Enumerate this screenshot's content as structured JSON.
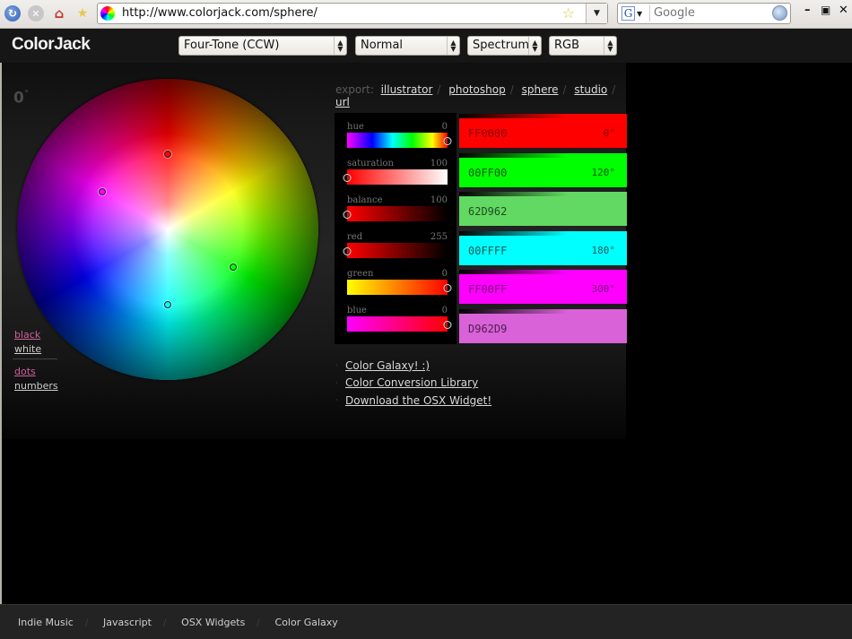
{
  "browser": {
    "url": "http://www.colorjack.com/sphere/",
    "search_placeholder": "Google",
    "search_engine": "G",
    "buttons": {
      "minimize": "–",
      "maximize": "🗗",
      "close": "✕"
    }
  },
  "header": {
    "logo": "ColorJack",
    "selects": {
      "scheme": "Four-Tone (CCW)",
      "mode": "Normal",
      "palette": "Spectrum",
      "model": "RGB"
    }
  },
  "wheel": {
    "angle": "0",
    "angle_unit": "°",
    "markers": [
      {
        "name": "red",
        "color": "#FF0000",
        "hue": 0
      },
      {
        "name": "green",
        "color": "#00FF00",
        "hue": 120
      },
      {
        "name": "cyan",
        "color": "#00FFFF",
        "hue": 180
      },
      {
        "name": "magenta",
        "color": "#FF00FF",
        "hue": 300
      }
    ]
  },
  "side_options": {
    "background": [
      {
        "label": "black",
        "active": true
      },
      {
        "label": "white",
        "active": false
      }
    ],
    "display": [
      {
        "label": "dots",
        "active": true
      },
      {
        "label": "numbers",
        "active": false
      }
    ]
  },
  "export": {
    "label": "export:",
    "links": [
      "illustrator",
      "photoshop",
      "sphere",
      "studio",
      "url"
    ]
  },
  "sliders": [
    {
      "label": "hue",
      "value": "0",
      "position": 1.0
    },
    {
      "label": "saturation",
      "value": "100",
      "position": 0.0
    },
    {
      "label": "balance",
      "value": "100",
      "position": 0.0
    },
    {
      "label": "red",
      "value": "255",
      "position": 0.0
    },
    {
      "label": "green",
      "value": "0",
      "position": 1.0
    },
    {
      "label": "blue",
      "value": "0",
      "position": 1.0
    }
  ],
  "swatches": [
    {
      "hex": "FF0000",
      "angle": "0°",
      "bg": "#FF0000",
      "fg": "#8a0000"
    },
    {
      "hex": "00FF00",
      "angle": "120°",
      "bg": "#00FF00",
      "fg": "#0a5a0a"
    },
    {
      "hex": "62D962",
      "angle": "",
      "bg": "#62D962",
      "fg": "#1f4d1f"
    },
    {
      "hex": "00FFFF",
      "angle": "180°",
      "bg": "#00FFFF",
      "fg": "#0b5a5a"
    },
    {
      "hex": "FF00FF",
      "angle": "300°",
      "bg": "#FF00FF",
      "fg": "#7a0a7a"
    },
    {
      "hex": "D962D9",
      "angle": "",
      "bg": "#D962D9",
      "fg": "#4f1d4f"
    }
  ],
  "links": [
    "Color Galaxy! :)",
    "Color Conversion Library",
    "Download the OSX Widget!"
  ],
  "footer": [
    "Indie Music",
    "Javascript",
    "OSX Widgets",
    "Color Galaxy"
  ]
}
